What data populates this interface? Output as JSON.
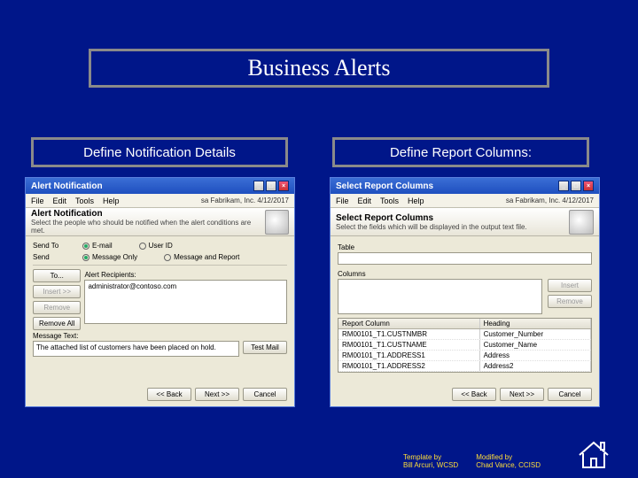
{
  "title": "Business Alerts",
  "left_heading": "Define Notification Details",
  "right_heading": "Define Report Columns:",
  "left_panel": {
    "window_title": "Alert Notification",
    "menus": [
      "File",
      "Edit",
      "Tools",
      "Help"
    ],
    "status_right": "sa  Fabrikam, Inc.  4/12/2017",
    "banner_title": "Alert Notification",
    "banner_sub": "Select the people who should be notified when the alert conditions are met.",
    "sendto_label": "Send To",
    "send_label": "Send",
    "sendto_opts": [
      "E-mail",
      "User ID"
    ],
    "send_opts": [
      "Message Only",
      "Message and Report"
    ],
    "sendto_selected": 0,
    "send_selected": 0,
    "to_btn": "To...",
    "recip_label": "Alert Recipients:",
    "recip_value": "administrator@contoso.com",
    "insert_btn": "Insert >>",
    "remove_btn": "Remove",
    "removeall_btn": "Remove All",
    "msg_label": "Message Text:",
    "msg_value": "The attached list of customers have been placed on hold.",
    "testmail_btn": "Test Mail",
    "back_btn": "<< Back",
    "next_btn": "Next >>",
    "cancel_btn": "Cancel"
  },
  "right_panel": {
    "window_title": "Select Report Columns",
    "menus": [
      "File",
      "Edit",
      "Tools",
      "Help"
    ],
    "status_right": "sa  Fabrikam, Inc.  4/12/2017",
    "banner_title": "Select Report Columns",
    "banner_sub": "Select the fields which will be displayed in the output text file.",
    "table_label": "Table",
    "columns_label": "Columns",
    "insert_btn": "Insert",
    "remove_btn": "Remove",
    "list_header": [
      "Report Column",
      "Heading"
    ],
    "rows": [
      [
        "RM00101_T1.CUSTNMBR",
        "Customer_Number"
      ],
      [
        "RM00101_T1.CUSTNAME",
        "Customer_Name"
      ],
      [
        "RM00101_T1.ADDRESS1",
        "Address"
      ],
      [
        "RM00101_T1.ADDRESS2",
        "Address2"
      ]
    ],
    "back_btn": "<< Back",
    "next_btn": "Next >>",
    "cancel_btn": "Cancel"
  },
  "credits": {
    "c1_h": "Template by",
    "c1_v": "Bill Arcuri, WCSD",
    "c2_h": "Modified by",
    "c2_v": "Chad Vance, CCISD"
  }
}
